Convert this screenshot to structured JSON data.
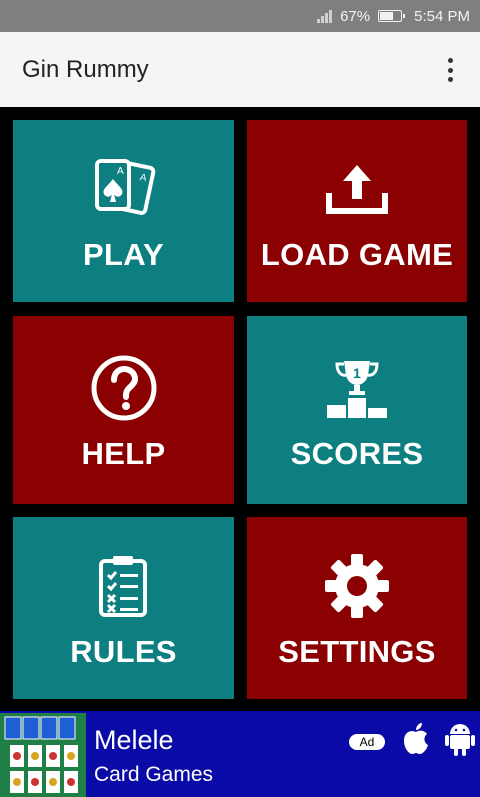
{
  "status_bar": {
    "battery": "67%",
    "time": "5:54 PM",
    "battery_level": 0.67
  },
  "app_bar": {
    "title": "Gin Rummy",
    "menu_icon": "more-vertical-icon"
  },
  "tiles": [
    {
      "label": "PLAY",
      "icon": "playing-cards-icon",
      "color": "#0d7f80"
    },
    {
      "label": "LOAD GAME",
      "icon": "upload-icon",
      "color": "#8b0000"
    },
    {
      "label": "HELP",
      "icon": "question-circle-icon",
      "color": "#8b0000"
    },
    {
      "label": "SCORES",
      "icon": "trophy-podium-icon",
      "color": "#0d7f80"
    },
    {
      "label": "RULES",
      "icon": "clipboard-checklist-icon",
      "color": "#0d7f80"
    },
    {
      "label": "SETTINGS",
      "icon": "gear-icon",
      "color": "#8b0000"
    }
  ],
  "ad_banner": {
    "title": "Melele",
    "subtitle": "Card Games",
    "badge": "Ad",
    "icons": [
      "apple-icon",
      "android-icon"
    ],
    "background": "#0a0aa6"
  }
}
